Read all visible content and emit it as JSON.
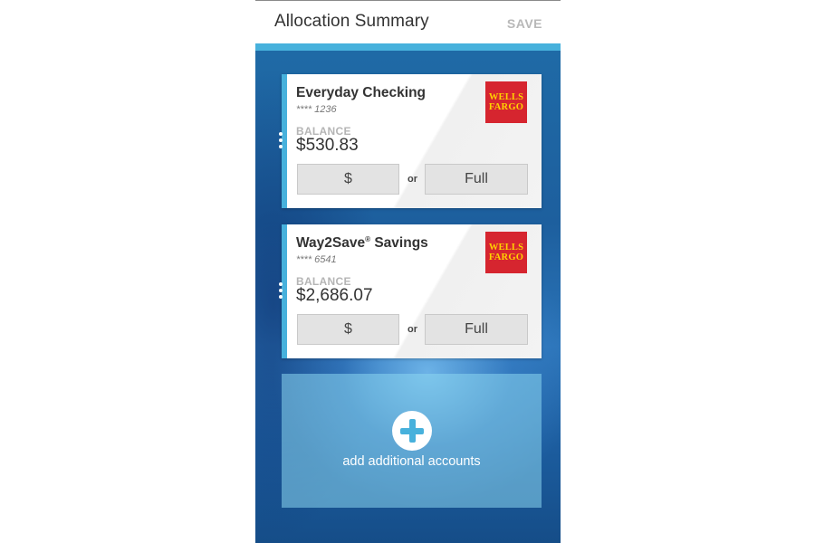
{
  "header": {
    "title": "Allocation Summary",
    "save_label": "SAVE"
  },
  "accounts": [
    {
      "name": "Everyday Checking",
      "trademark": "",
      "name_suffix": "",
      "masked_number": "**** 1236",
      "bank_logo_line1": "WELLS",
      "bank_logo_line2": "FARGO",
      "balance_label": "BALANCE",
      "balance": "$530.83",
      "amount_button": "$",
      "or_text": "or",
      "full_button": "Full"
    },
    {
      "name": "Way2Save",
      "trademark": "®",
      "name_suffix": " Savings",
      "masked_number": "**** 6541",
      "bank_logo_line1": "WELLS",
      "bank_logo_line2": "FARGO",
      "balance_label": "BALANCE",
      "balance": "$2,686.07",
      "amount_button": "$",
      "or_text": "or",
      "full_button": "Full"
    }
  ],
  "add_accounts": {
    "label": "add additional accounts",
    "icon": "plus-circle-icon"
  },
  "colors": {
    "accent": "#47b1dc",
    "logo_red": "#d6252f",
    "logo_gold": "#ffd200",
    "background_blue": "#1f6aa6"
  }
}
